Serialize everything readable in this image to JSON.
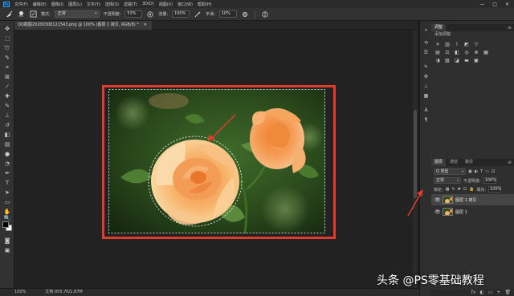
{
  "menubar": {
    "logo": "Ps",
    "items": [
      "文件(F)",
      "编辑(E)",
      "图像(I)",
      "图层(L)",
      "文字(Y)",
      "选择(S)",
      "滤镜(T)",
      "3D(D)",
      "视图(V)",
      "窗口(W)",
      "帮助(H)"
    ],
    "window_buttons": [
      "—",
      "□",
      "✕"
    ]
  },
  "options": {
    "brush_size": "256",
    "mode_label": "模式:",
    "mode_value": "正常",
    "opacity_label": "不透明度:",
    "opacity_value": "53%",
    "flow_label": "流量:",
    "flow_value": "100%",
    "smooth_label": "平滑:",
    "smooth_value": "10%"
  },
  "document": {
    "tab_title": "QQ截图20200308121543.png @ 100% (图层 1 拷贝, RGB/8) *",
    "close": "✕"
  },
  "status": {
    "zoom": "100%",
    "doc_info": "文档:955.7K/1.87M"
  },
  "panels": {
    "adjust_tab": "调整",
    "adjust_subtitle": "添加调整",
    "layers_tabs": [
      "图层",
      "通道",
      "路径"
    ],
    "kind_filter": "Q 类型",
    "blend_mode": "正常",
    "opacity_label": "不透明度:",
    "opacity_value": "100%",
    "lock_label": "锁定:",
    "fill_label": "填充:",
    "fill_value": "100%",
    "layers": [
      {
        "name": "图层 1 拷贝",
        "selected": true
      },
      {
        "name": "图层 1",
        "selected": false
      }
    ],
    "bottom_icons": [
      "fx",
      "◐",
      "▭",
      "+",
      "🗑"
    ]
  },
  "watermark": "头条 @PS零基础教程",
  "colors": {
    "highlight": "#e23b2e",
    "arrow": "#e23b2e",
    "accent": "#31a8ff"
  }
}
